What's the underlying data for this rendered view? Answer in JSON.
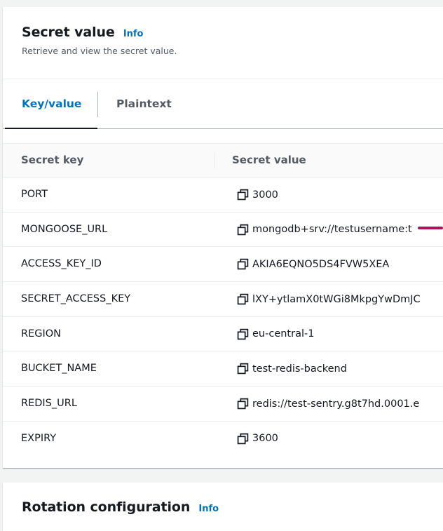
{
  "secret_panel": {
    "title": "Secret value",
    "info": "Info",
    "description": "Retrieve and view the secret value.",
    "tabs": [
      {
        "label": "Key/value",
        "active": true
      },
      {
        "label": "Plaintext",
        "active": false
      }
    ],
    "table": {
      "headers": [
        "Secret key",
        "Secret value"
      ],
      "rows": [
        {
          "key": "PORT",
          "value": "3000"
        },
        {
          "key": "MONGOOSE_URL",
          "value": "mongodb+srv://testusername:t"
        },
        {
          "key": "ACCESS_KEY_ID",
          "value": "AKIA6EQNO5DS4FVW5XEA"
        },
        {
          "key": "SECRET_ACCESS_KEY",
          "value": "lXY+ytlamX0tWGi8MkpgYwDmJC"
        },
        {
          "key": "REGION",
          "value": "eu-central-1"
        },
        {
          "key": "BUCKET_NAME",
          "value": "test-redis-backend"
        },
        {
          "key": "REDIS_URL",
          "value": "redis://test-sentry.g8t7hd.0001.e"
        },
        {
          "key": "EXPIRY",
          "value": "3600"
        }
      ]
    }
  },
  "rotation_panel": {
    "title": "Rotation configuration",
    "info": "Info"
  },
  "icons": {
    "copy": "copy-icon"
  },
  "colors": {
    "link": "#0073bb",
    "text": "#16191f",
    "muted": "#545b64",
    "annotation": "#b0125a"
  }
}
